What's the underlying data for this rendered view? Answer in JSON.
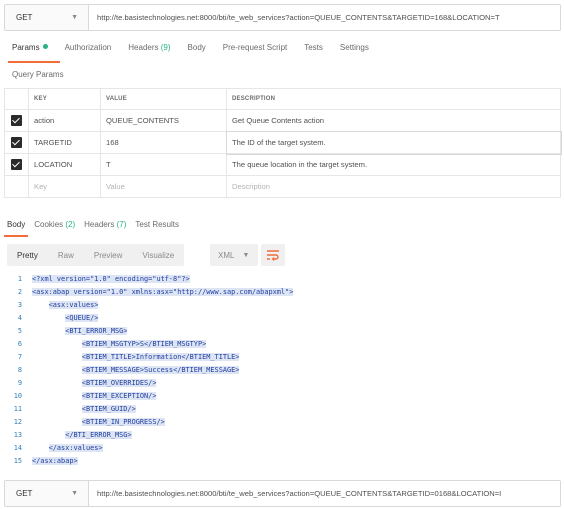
{
  "request_top": {
    "method": "GET",
    "url": "http://te.basistechnologies.net:8000/bti/te_web_services?action=QUEUE_CONTENTS&TARGETID=168&LOCATION=T"
  },
  "request_tabs": [
    {
      "label": "Params",
      "count": ""
    },
    {
      "label": "Authorization",
      "count": ""
    },
    {
      "label": "Headers",
      "count": "(9)"
    },
    {
      "label": "Body",
      "count": ""
    },
    {
      "label": "Pre-request Script",
      "count": ""
    },
    {
      "label": "Tests",
      "count": ""
    },
    {
      "label": "Settings",
      "count": ""
    }
  ],
  "query_params": {
    "title": "Query Params",
    "headers": {
      "key": "KEY",
      "value": "VALUE",
      "description": "DESCRIPTION"
    },
    "rows": [
      {
        "key": "action",
        "value": "QUEUE_CONTENTS",
        "description": "Get Queue Contents action"
      },
      {
        "key": "TARGETID",
        "value": "168",
        "description": "The ID of the target system."
      },
      {
        "key": "LOCATION",
        "value": "T",
        "description": "The queue location in the target system."
      }
    ],
    "placeholder": {
      "key": "Key",
      "value": "Value",
      "description": "Description"
    }
  },
  "response_tabs": [
    {
      "label": "Body",
      "count": ""
    },
    {
      "label": "Cookies",
      "count": "(2)"
    },
    {
      "label": "Headers",
      "count": "(7)"
    },
    {
      "label": "Test Results",
      "count": ""
    }
  ],
  "view_modes": [
    "Pretty",
    "Raw",
    "Preview",
    "Visualize"
  ],
  "format": "XML",
  "wrap_icon": "wrap-lines-icon",
  "code_lines": [
    {
      "n": "1",
      "indent": "",
      "text": "<?xml version=\"1.0\" encoding=\"utf-8\"?>"
    },
    {
      "n": "2",
      "indent": "",
      "text": "<asx:abap version=\"1.0\" xmlns:asx=\"http://www.sap.com/abapxml\">"
    },
    {
      "n": "3",
      "indent": "    ",
      "text": "<asx:values>"
    },
    {
      "n": "4",
      "indent": "        ",
      "text": "<QUEUE/>"
    },
    {
      "n": "5",
      "indent": "        ",
      "text": "<BTI_ERROR_MSG>"
    },
    {
      "n": "6",
      "indent": "            ",
      "text": "<BTIEM_MSGTYP>S</BTIEM_MSGTYP>"
    },
    {
      "n": "7",
      "indent": "            ",
      "text": "<BTIEM_TITLE>Information</BTIEM_TITLE>"
    },
    {
      "n": "8",
      "indent": "            ",
      "text": "<BTIEM_MESSAGE>Success</BTIEM_MESSAGE>"
    },
    {
      "n": "9",
      "indent": "            ",
      "text": "<BTIEM_OVERRIDES/>"
    },
    {
      "n": "10",
      "indent": "            ",
      "text": "<BTIEM_EXCEPTION/>"
    },
    {
      "n": "11",
      "indent": "            ",
      "text": "<BTIEM_GUID/>"
    },
    {
      "n": "12",
      "indent": "            ",
      "text": "<BTIEM_IN_PROGRESS/>"
    },
    {
      "n": "13",
      "indent": "        ",
      "text": "</BTI_ERROR_MSG>"
    },
    {
      "n": "14",
      "indent": "    ",
      "text": "</asx:values>"
    },
    {
      "n": "15",
      "indent": "",
      "text": "</asx:abap>"
    }
  ],
  "request_bottom": {
    "method": "GET",
    "url": "http://te.basistechnologies.net:8000/bti/te_web_services?action=QUEUE_CONTENTS&TARGETID=0168&LOCATION=I"
  },
  "colors": {
    "accent": "#f26b3a",
    "green": "#26b47f",
    "code": "#1f3fa0",
    "selection": "#dde4f4"
  }
}
